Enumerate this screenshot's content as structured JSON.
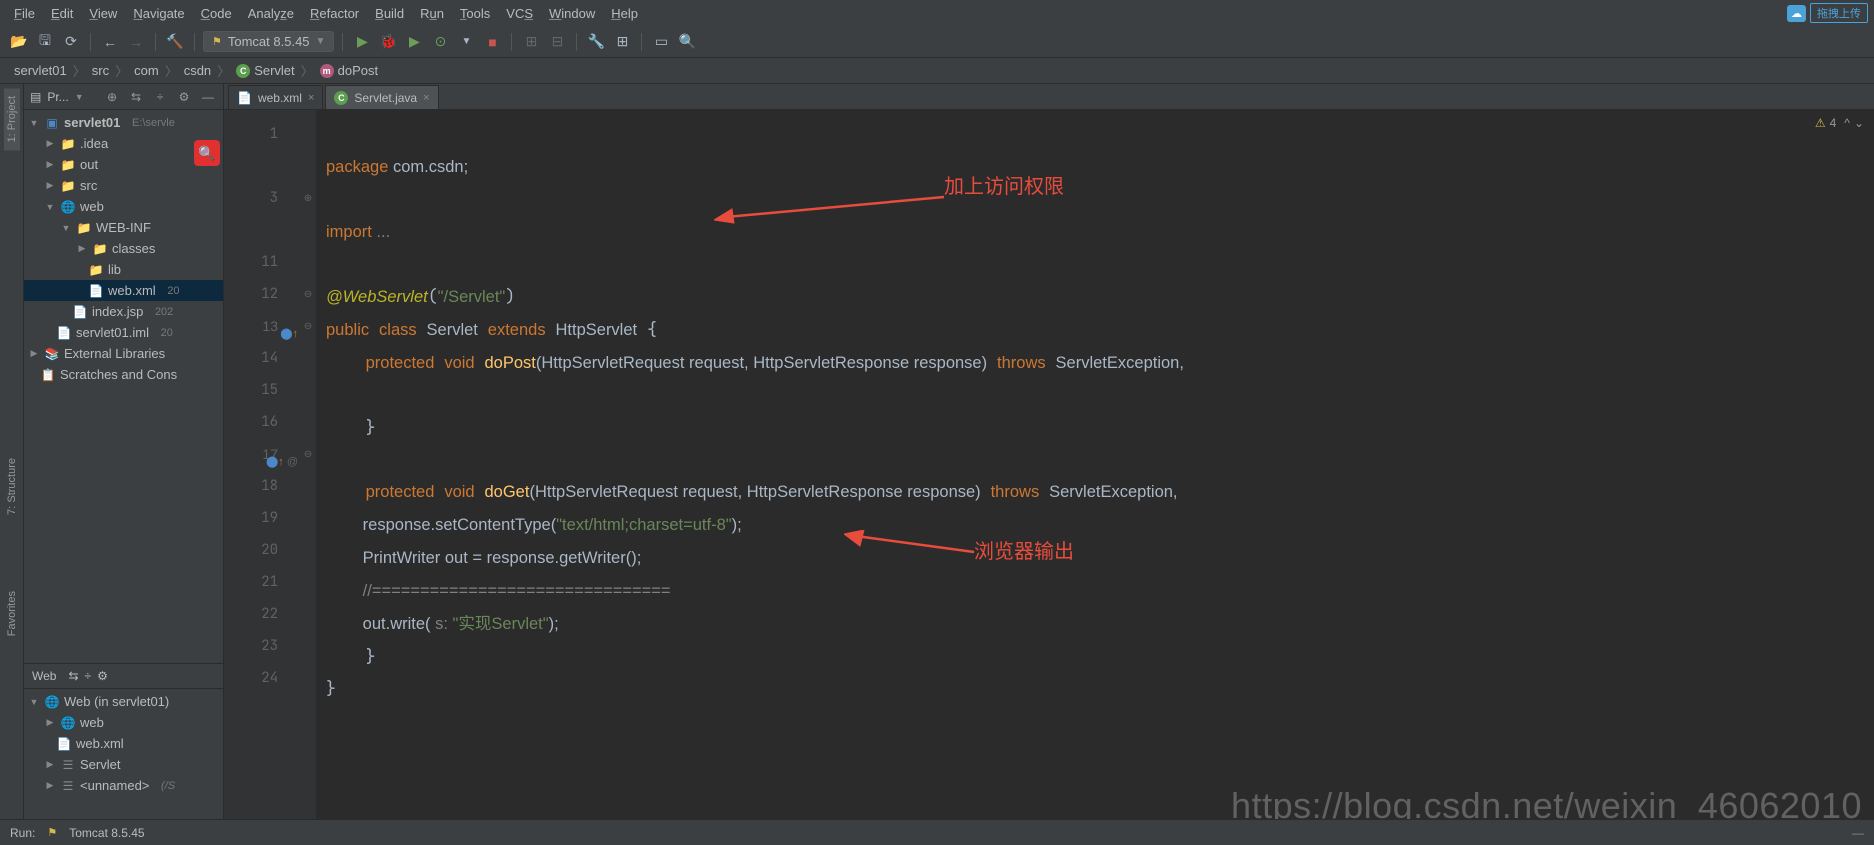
{
  "menu": [
    "File",
    "Edit",
    "View",
    "Navigate",
    "Code",
    "Analyze",
    "Refactor",
    "Build",
    "Run",
    "Tools",
    "VCS",
    "Window",
    "Help"
  ],
  "cloud_button": "拖拽上传",
  "run_config": "Tomcat 8.5.45",
  "breadcrumb": {
    "p1": "servlet01",
    "p2": "src",
    "p3": "com",
    "p4": "csdn",
    "p5": "Servlet",
    "p6": "doPost"
  },
  "project_panel_label": "Pr...",
  "project_tree": {
    "root": "servlet01",
    "root_path": "E:\\servle",
    "idea": ".idea",
    "out": "out",
    "src": "src",
    "web": "web",
    "webinf": "WEB-INF",
    "classes": "classes",
    "lib": "lib",
    "webxml": "web.xml",
    "index": "index.jsp",
    "iml": "servlet01.iml",
    "ext": "External Libraries",
    "scratch": "Scratches and Cons",
    "date1": "20",
    "date2": "202",
    "date3": "20"
  },
  "web_panel_label": "Web",
  "web_tree": {
    "root": "Web (in servlet01)",
    "web": "web",
    "webxml": "web.xml",
    "servlet": "Servlet",
    "unnamed": "<unnamed>",
    "unnamed_suffix": "(/S"
  },
  "tabs": {
    "t1": "web.xml",
    "t2": "Servlet.java"
  },
  "warnings_count": "4",
  "annotations": {
    "a1": "加上访问权限",
    "a2": "浏览器输出"
  },
  "watermark": "https://blog.csdn.net/weixin_46062010",
  "run_tool": "Run:",
  "run_tool_config": "Tomcat 8.5.45",
  "side_tabs": {
    "project": "1: Project",
    "structure": "7: Structure",
    "favorites": "Favorites"
  },
  "code": {
    "l1_kw": "package",
    "l1_rest": " com.csdn;",
    "l3_kw": "import",
    "l3_rest": " ...",
    "l5_ann": "@WebServlet",
    "l5_str": "\"/Servlet\"",
    "l6_kw1": "public",
    "l6_kw2": "class",
    "l6_name": "Servlet",
    "l6_kw3": "extends",
    "l6_sup": "HttpServlet",
    "l7_kw1": "protected",
    "l7_kw2": "void",
    "l7_fn": "doPost",
    "l7_sig": "(HttpServletRequest request, HttpServletResponse response)",
    "l7_kw3": "throws",
    "l7_exc": "ServletException,",
    "l11_kw1": "protected",
    "l11_kw2": "void",
    "l11_fn": "doGet",
    "l11_sig": "(HttpServletRequest request, HttpServletResponse response)",
    "l11_kw3": "throws",
    "l11_exc": "ServletException, ",
    "l12_a": "        response.setContentType(",
    "l12_str": "\"text/html;charset=utf-8\"",
    "l12_b": ");",
    "l13": "        PrintWriter out = response.getWriter();",
    "l14": "        //===============================",
    "l15_a": "        out.write(",
    "l15_p": " s: ",
    "l15_str": "\"实现Servlet\"",
    "l15_b": ");"
  },
  "line_numbers": [
    "1",
    "",
    "3",
    "",
    "11",
    "12",
    "13",
    "14",
    "15",
    "16",
    "17",
    "18",
    "19",
    "20",
    "21",
    "22",
    "23",
    "24"
  ]
}
